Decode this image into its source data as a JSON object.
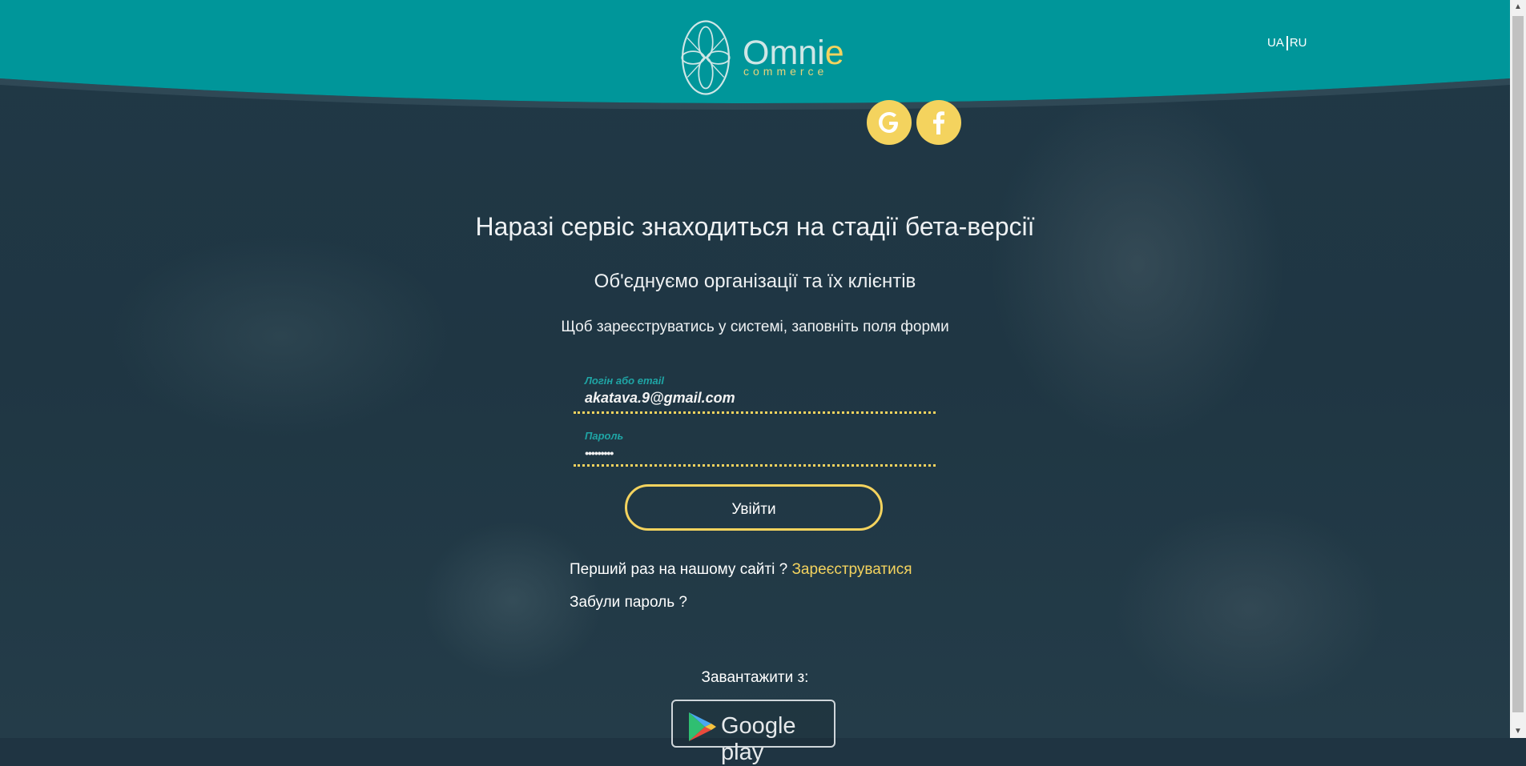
{
  "header": {
    "logo_word": "Omni",
    "logo_word_e": "e",
    "logo_sub": "commerce",
    "lang_ua": "UA",
    "lang_ru": "RU"
  },
  "social": {
    "google_icon": "google-icon",
    "facebook_icon": "facebook-icon"
  },
  "main": {
    "title": "Наразі сервіс знаходиться на стадії бета-версії",
    "subtitle": "Об'єднуємо організації та їх клієнтів",
    "instruction": "Щоб зареєструватись у системі, заповніть поля форми"
  },
  "form": {
    "login_label": "Логін або email",
    "login_value": "akatava.9@gmail.com",
    "password_label": "Пароль",
    "password_value": "123456789",
    "submit_label": "Увійти"
  },
  "links": {
    "first_time": "Перший раз на нашому сайті ? ",
    "register": "Зареєструватися",
    "forgot": "Забули пароль ?"
  },
  "download": {
    "label": "Завантажити з:",
    "store": "Google play"
  },
  "colors": {
    "teal": "#00969a",
    "yellow": "#f4d35e",
    "background": "#1f3442"
  }
}
